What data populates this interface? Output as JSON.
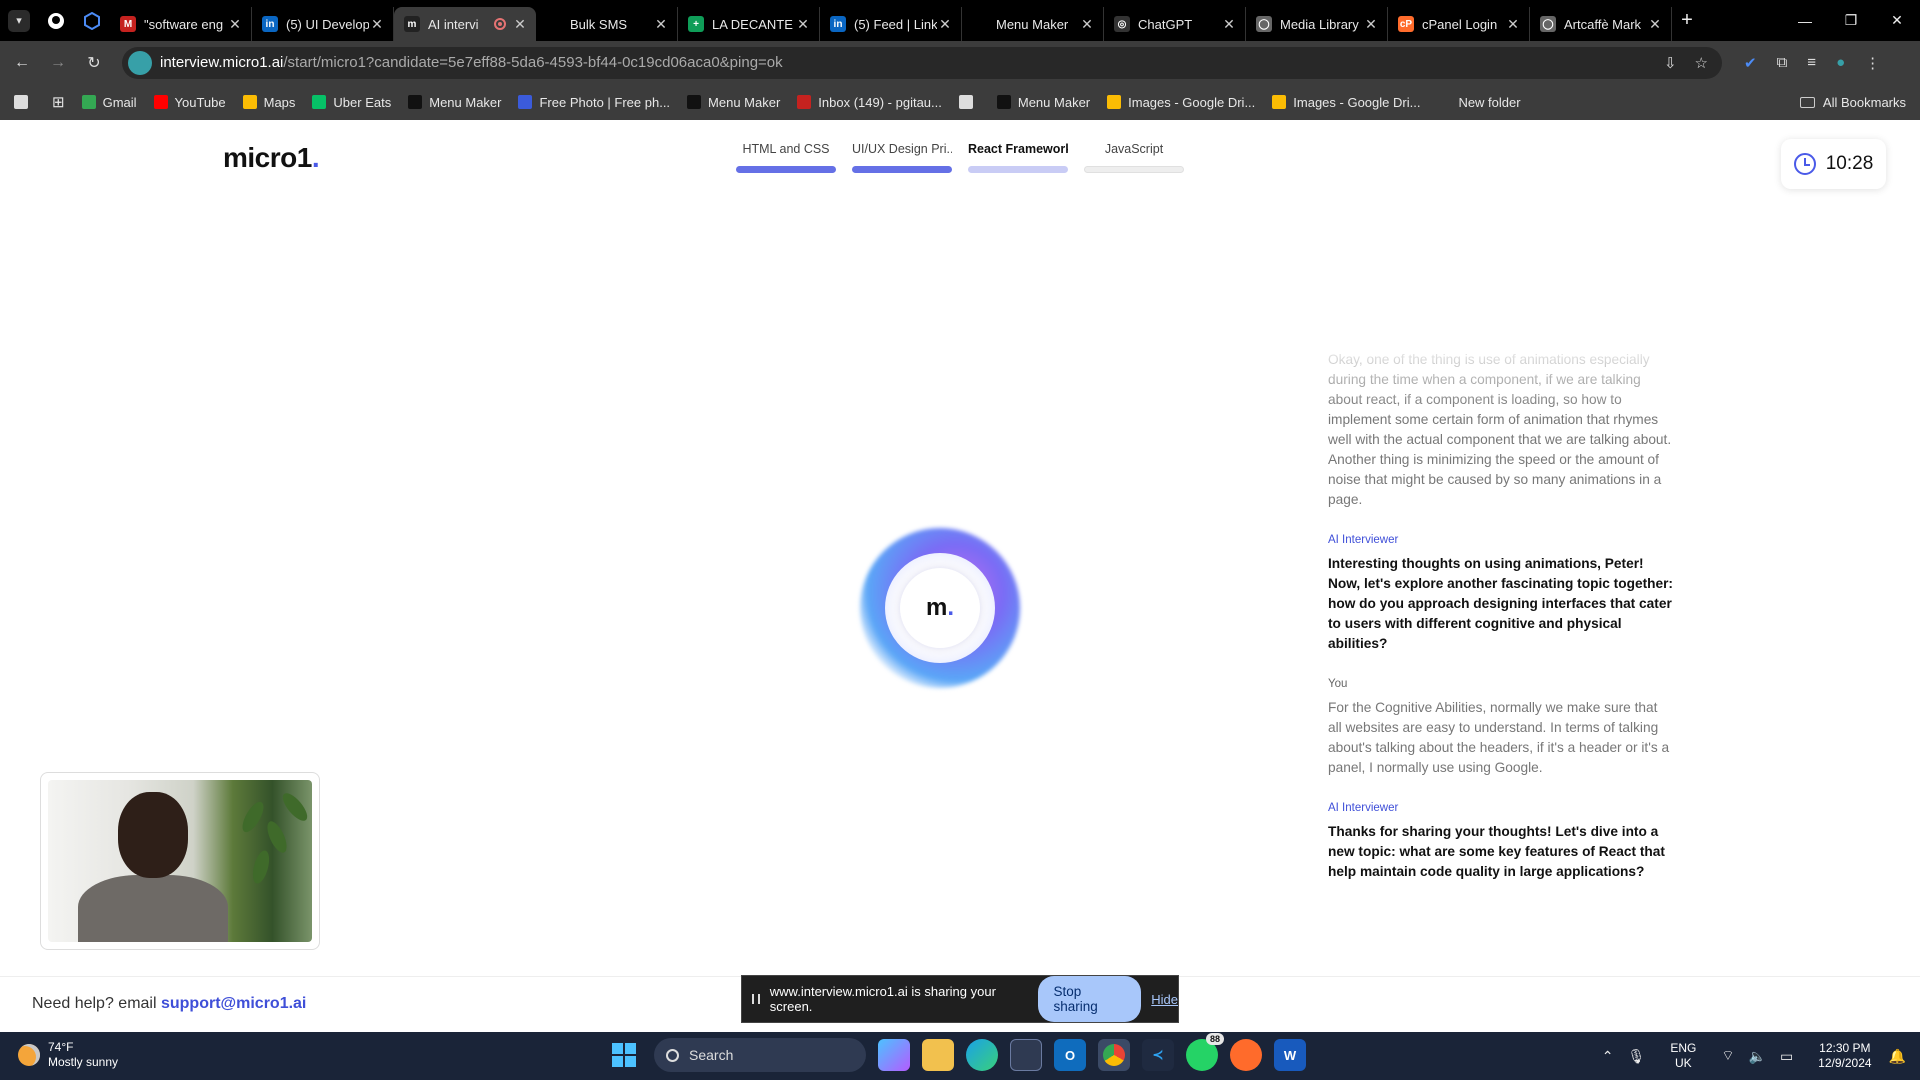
{
  "browser": {
    "tabs": [
      {
        "title": "\"software eng",
        "color": "#c5221f",
        "glyph": "M"
      },
      {
        "title": "(5) UI Develop",
        "color": "#0a66c2",
        "glyph": "in"
      },
      {
        "title": "AI intervi",
        "color": "#222222",
        "glyph": "m",
        "active": true,
        "recording": true
      },
      {
        "title": "Bulk SMS",
        "color": "#000000",
        "glyph": ""
      },
      {
        "title": "LA DECANTE",
        "color": "#0f9d58",
        "glyph": "+"
      },
      {
        "title": "(5) Feed | Link",
        "color": "#0a66c2",
        "glyph": "in"
      },
      {
        "title": "Menu Maker",
        "color": "#000000",
        "glyph": ""
      },
      {
        "title": "ChatGPT",
        "color": "#333333",
        "glyph": "◎"
      },
      {
        "title": "Media Library",
        "color": "#666666",
        "glyph": "◯"
      },
      {
        "title": "cPanel Login",
        "color": "#ff6c2c",
        "glyph": "cP"
      },
      {
        "title": "Artcaffè Mark",
        "color": "#666666",
        "glyph": "◯"
      }
    ],
    "url_host": "interview.micro1.ai",
    "url_path": "/start/micro1?candidate=5e7eff88-5da6-4593-bf44-0c19cd06aca0&ping=ok",
    "bookmarks": [
      {
        "label": "Gmail",
        "color": "#34a853"
      },
      {
        "label": "YouTube",
        "color": "#ff0000"
      },
      {
        "label": "Maps",
        "color": "#fbbc04"
      },
      {
        "label": "Uber Eats",
        "color": "#06c167"
      },
      {
        "label": "Menu Maker",
        "color": "#111111"
      },
      {
        "label": "Free Photo | Free ph...",
        "color": "#3b5bdb"
      },
      {
        "label": "Menu Maker",
        "color": "#111111"
      },
      {
        "label": "Inbox (149) - pgitau...",
        "color": "#c5221f"
      },
      {
        "label": "",
        "color": "#dddddd"
      },
      {
        "label": "Menu Maker",
        "color": "#111111"
      },
      {
        "label": "Images - Google Dri...",
        "color": "#fbbc04"
      },
      {
        "label": "Images - Google Dri...",
        "color": "#fbbc04"
      },
      {
        "label": "New folder",
        "color": "#3c3c3c"
      }
    ],
    "all_bookmarks": "All Bookmarks"
  },
  "page": {
    "logo": "micro1",
    "logo_dot": ".",
    "steps": [
      {
        "label": "HTML and CSS",
        "state": "done"
      },
      {
        "label": "UI/UX Design Pri...",
        "state": "done"
      },
      {
        "label": "React Framework",
        "state": "current"
      },
      {
        "label": "JavaScript",
        "state": "pending"
      }
    ],
    "timer": "10:28",
    "orb_label": "m",
    "orb_dot": ".",
    "transcript": [
      {
        "speaker": "",
        "role": "user",
        "faded": true,
        "text": "Okay, one of the thing is use of animations especially during the time when a component, if we are talking about react, if a component is loading, so how to implement some certain form of animation that rhymes well with the actual component that we are talking about. Another thing is minimizing the speed or the amount of noise that might be caused by so many animations in a page."
      },
      {
        "speaker": "AI Interviewer",
        "role": "ai",
        "text": "Interesting thoughts on using animations, Peter! Now, let's explore another fascinating topic together: how do you approach designing interfaces that cater to users with different cognitive and physical abilities?"
      },
      {
        "speaker": "You",
        "role": "user",
        "text": "For the Cognitive Abilities, normally we make sure that all websites are easy to understand. In terms of talking about's talking about the headers, if it's a header or it's a panel, I normally use using Google."
      },
      {
        "speaker": "AI Interviewer",
        "role": "ai",
        "text": "Thanks for sharing your thoughts! Let's dive into a new topic: what are some key features of React that help maintain code quality in large applications?"
      }
    ],
    "help_text": "Need help? email ",
    "help_email": "support@micro1.ai"
  },
  "share_bar": {
    "message": "www.interview.micro1.ai is sharing your screen.",
    "stop": "Stop sharing",
    "hide": "Hide"
  },
  "taskbar": {
    "temp": "74°F",
    "weather": "Mostly sunny",
    "search": "Search",
    "whatsapp_badge": "88",
    "lang1": "ENG",
    "lang2": "UK",
    "time": "12:30 PM",
    "date": "12/9/2024"
  }
}
